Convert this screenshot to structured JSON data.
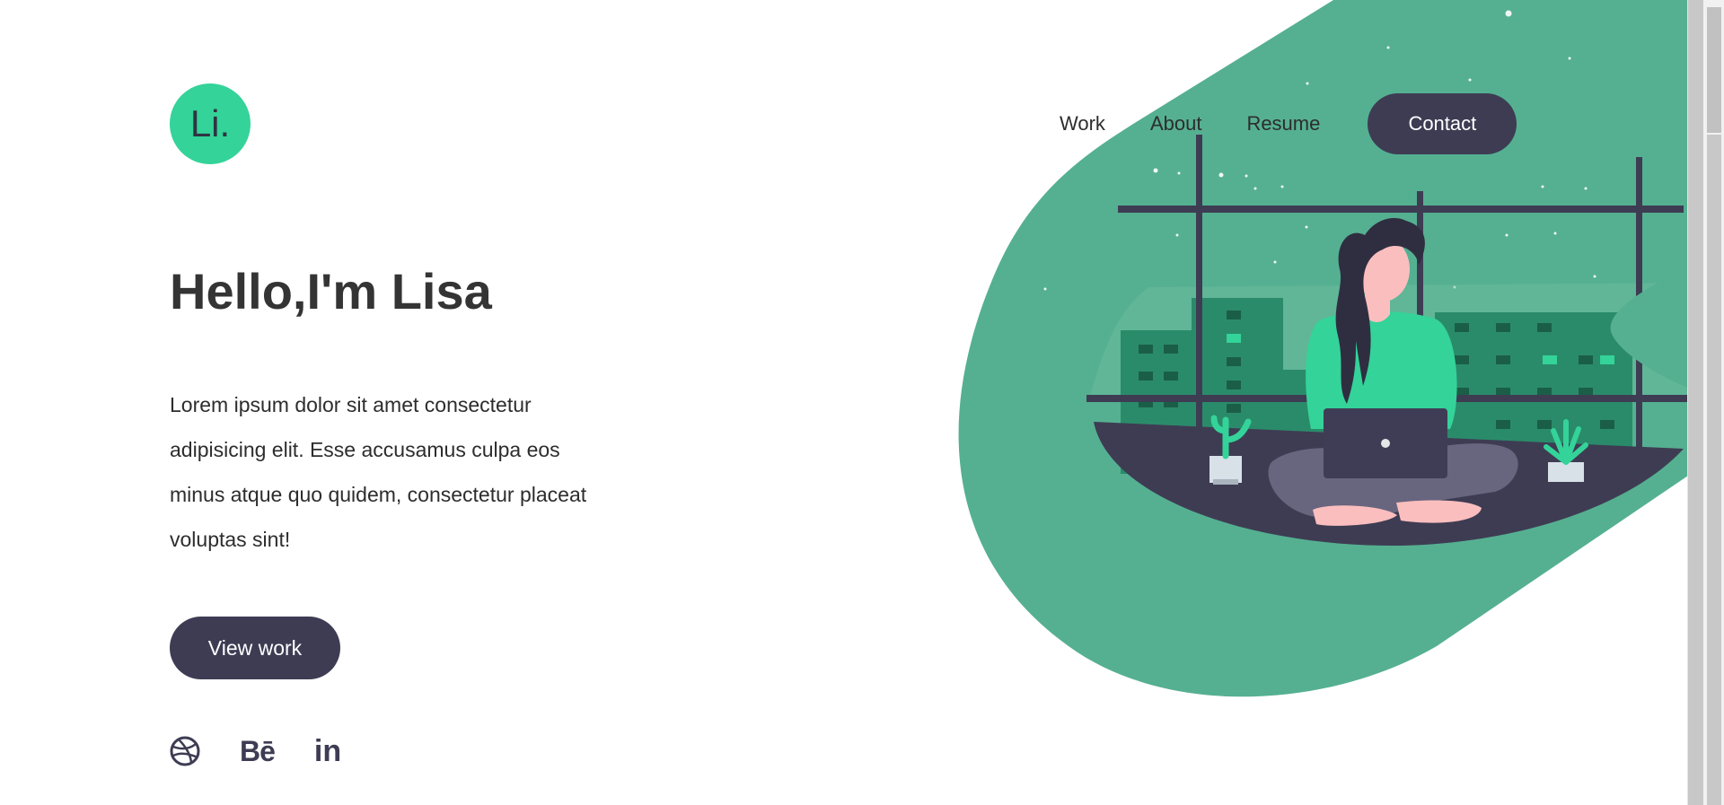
{
  "brand": {
    "logo_text": "Li."
  },
  "nav": {
    "items": [
      {
        "label": "Work"
      },
      {
        "label": "About"
      },
      {
        "label": "Resume"
      }
    ],
    "contact_label": "Contact"
  },
  "hero": {
    "title": "Hello,I'm Lisa",
    "description": "Lorem ipsum dolor sit amet consectetur adipisicing elit. Esse accusamus culpa eos minus atque quo quidem, consectetur placeat voluptas sint!",
    "cta_label": "View work"
  },
  "socials": [
    {
      "name": "dribbble-icon",
      "glyph": ""
    },
    {
      "name": "behance-icon",
      "glyph": "Bē"
    },
    {
      "name": "linkedin-icon",
      "glyph": "in"
    }
  ],
  "colors": {
    "accent": "#34d399",
    "blob": "#55b091",
    "dark": "#3e3c53",
    "text": "#343434"
  }
}
